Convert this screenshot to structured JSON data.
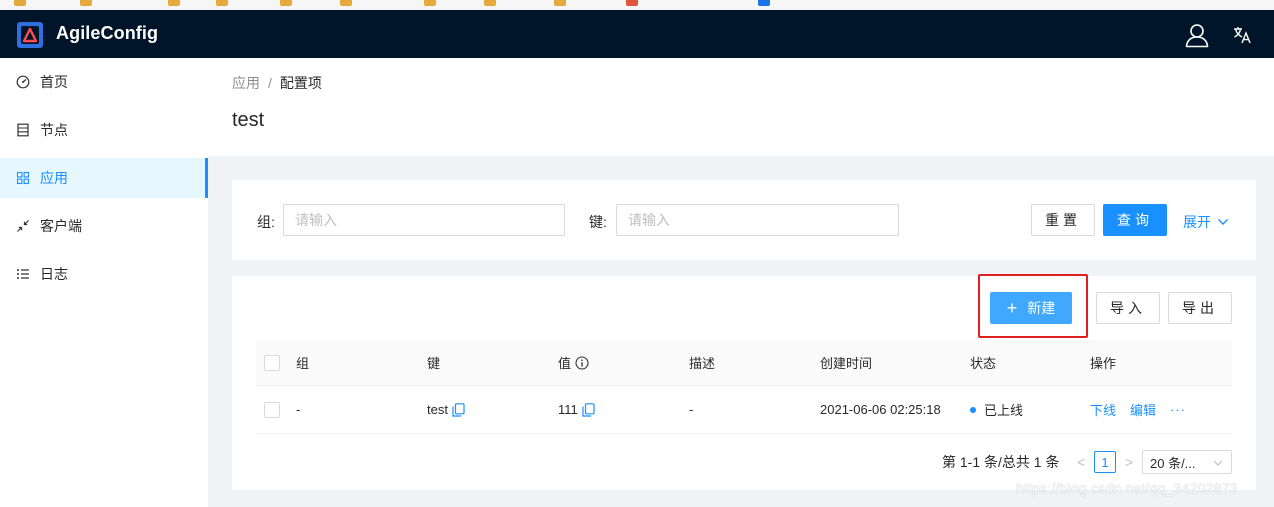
{
  "app": {
    "title": "AgileConfig"
  },
  "header": {
    "user_icon": "user-icon",
    "lang_icon": "translate-icon"
  },
  "sidebar": {
    "items": [
      {
        "label": "首页",
        "icon": "dashboard-icon",
        "active": false
      },
      {
        "label": "节点",
        "icon": "database-icon",
        "active": false
      },
      {
        "label": "应用",
        "icon": "appstore-icon",
        "active": true
      },
      {
        "label": "客户端",
        "icon": "shrink-icon",
        "active": false
      },
      {
        "label": "日志",
        "icon": "unordered-list-icon",
        "active": false
      }
    ]
  },
  "breadcrumb": {
    "items": [
      "应用",
      "配置项"
    ],
    "separator": "/"
  },
  "page": {
    "title": "test"
  },
  "search": {
    "group_label": "组:",
    "group_placeholder": "请输入",
    "key_label": "键:",
    "key_placeholder": "请输入",
    "reset_label": "重置",
    "query_label": "查询",
    "expand_label": "展开"
  },
  "toolbar": {
    "new_label": "新建",
    "import_label": "导入",
    "export_label": "导出"
  },
  "table": {
    "columns": [
      "组",
      "键",
      "值",
      "描述",
      "创建时间",
      "状态",
      "操作"
    ],
    "rows": [
      {
        "group": "-",
        "key": "test",
        "value": "111",
        "description": "-",
        "created": "2021-06-06 02:25:18",
        "status": "已上线",
        "actions": [
          "下线",
          "编辑",
          "···"
        ]
      }
    ]
  },
  "pagination": {
    "summary": "第 1-1 条/总共 1 条",
    "prev": "<",
    "current": "1",
    "next": ">",
    "page_size": "20 条/..."
  },
  "watermark": "https://blog.csdn.net/qq_34202873",
  "colors": {
    "header": "#001529",
    "primary": "#1890ff",
    "highlight": "#e02020"
  }
}
